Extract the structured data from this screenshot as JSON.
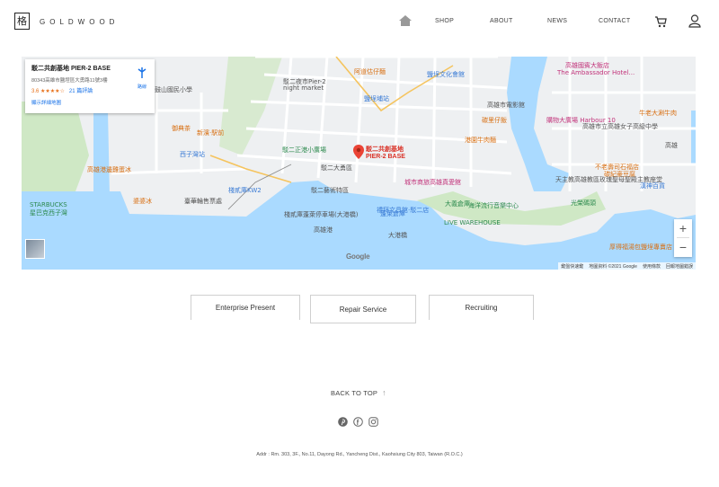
{
  "header": {
    "logo_mark": "格",
    "logo_text": "GOLDWOOD",
    "nav": [
      {
        "id": "shop",
        "label": "SHOP"
      },
      {
        "id": "about",
        "label": "ABOUT"
      },
      {
        "id": "news",
        "label": "NEWS"
      },
      {
        "id": "contact",
        "label": "CONTACT"
      }
    ],
    "icons": [
      "home-icon",
      "cart-icon",
      "user-icon"
    ]
  },
  "map": {
    "place": {
      "title": "駁二共創基地 PIER-2 BASE",
      "address": "80343高雄市鹽埕區大勇路11號3樓",
      "rating": "3.6 ★★★★☆",
      "reviews": "21 篇評論",
      "larger_map": "顯示詳細地圖",
      "directions": "路線"
    },
    "pin_label_line1": "駁二共創基地",
    "pin_label_line2": "PIER-2 BASE",
    "labels": [
      {
        "text": "阿道估仔麵",
        "cls": "orange"
      },
      {
        "text": "鹽埕文化會館",
        "cls": "blue"
      },
      {
        "text": "高雄國賓大飯店",
        "cls": "pink"
      },
      {
        "text": "The Ambassador Hotel...",
        "cls": "pink"
      },
      {
        "text": "駁二夜市Pier-2",
        "cls": ""
      },
      {
        "text": "night market",
        "cls": ""
      },
      {
        "text": "鹽埕埔站",
        "cls": "blue"
      },
      {
        "text": "高雄市電影館",
        "cls": ""
      },
      {
        "text": "鼓山國民小學",
        "cls": ""
      },
      {
        "text": "御典茶",
        "cls": "orange"
      },
      {
        "text": "新濱·駅前",
        "cls": "orange"
      },
      {
        "text": "駁二正港小廣場",
        "cls": "green"
      },
      {
        "text": "港園牛肉麵",
        "cls": "orange"
      },
      {
        "text": "西子灣站",
        "cls": "blue"
      },
      {
        "text": "高雄港邊雞蛋冰",
        "cls": "orange"
      },
      {
        "text": "駁二藝術特區",
        "cls": ""
      },
      {
        "text": "城市商旅高雄真愛館",
        "cls": "pink"
      },
      {
        "text": "棧貳庫KW2",
        "cls": "blue"
      },
      {
        "text": "駁二大勇區",
        "cls": ""
      },
      {
        "text": "大義倉庫",
        "cls": "green"
      },
      {
        "text": "海洋流行音樂中心",
        "cls": "green"
      },
      {
        "text": "光榮碼頭",
        "cls": "green"
      },
      {
        "text": "蓬萊倉庫",
        "cls": "blue"
      },
      {
        "text": "STARBUCKS",
        "cls": "green"
      },
      {
        "text": "星巴克西子灣",
        "cls": "green"
      },
      {
        "text": "臺華輪售票處",
        "cls": ""
      },
      {
        "text": "棧貳庫蓬萊停車場(大港橋)",
        "cls": ""
      },
      {
        "text": "禮拜文具館·駁二店",
        "cls": "blue"
      },
      {
        "text": "LIVE WAREHOUSE",
        "cls": "green"
      },
      {
        "text": "大港橋",
        "cls": ""
      },
      {
        "text": "婆婆冰",
        "cls": "orange"
      },
      {
        "text": "高雄市立高雄女子高級中學",
        "cls": ""
      },
      {
        "text": "牛老大涮牛肉",
        "cls": "orange"
      },
      {
        "text": "碳里仔飯",
        "cls": "orange"
      },
      {
        "text": "購物大廣場 Harbour 10",
        "cls": "pink"
      },
      {
        "text": "不老壽司石福店",
        "cls": "orange"
      },
      {
        "text": "碳紀豪豆腐",
        "cls": "orange"
      },
      {
        "text": "漢神百貨",
        "cls": "blue"
      },
      {
        "text": "天主教高雄教區玫瑰聖母聖殿主教座堂",
        "cls": ""
      },
      {
        "text": "厚得福湯包鹽埕專賣店",
        "cls": "orange"
      },
      {
        "text": "高雄",
        "cls": ""
      },
      {
        "text": "高雄港",
        "cls": ""
      }
    ],
    "google": "Google",
    "footer": [
      "鍵盤快速鍵",
      "地圖資料 ©2021 Google",
      "使用條款",
      "回報地圖錯誤"
    ],
    "zoom_in": "+",
    "zoom_out": "−"
  },
  "tabs": [
    {
      "label": "Enterprise Present",
      "active": false
    },
    {
      "label": "Repair Service",
      "active": true
    },
    {
      "label": "Recruiting",
      "active": false
    }
  ],
  "footer": {
    "back_to_top": "BACK TO TOP",
    "arrow": "↑",
    "social": [
      "pinterest-icon",
      "facebook-icon",
      "instagram-icon"
    ],
    "address": "Addr : Rm. 303, 3F., No.11, Dayong Rd., Yancheng Dist., Kaohsiung City 803, Taiwan (R.O.C.)"
  }
}
